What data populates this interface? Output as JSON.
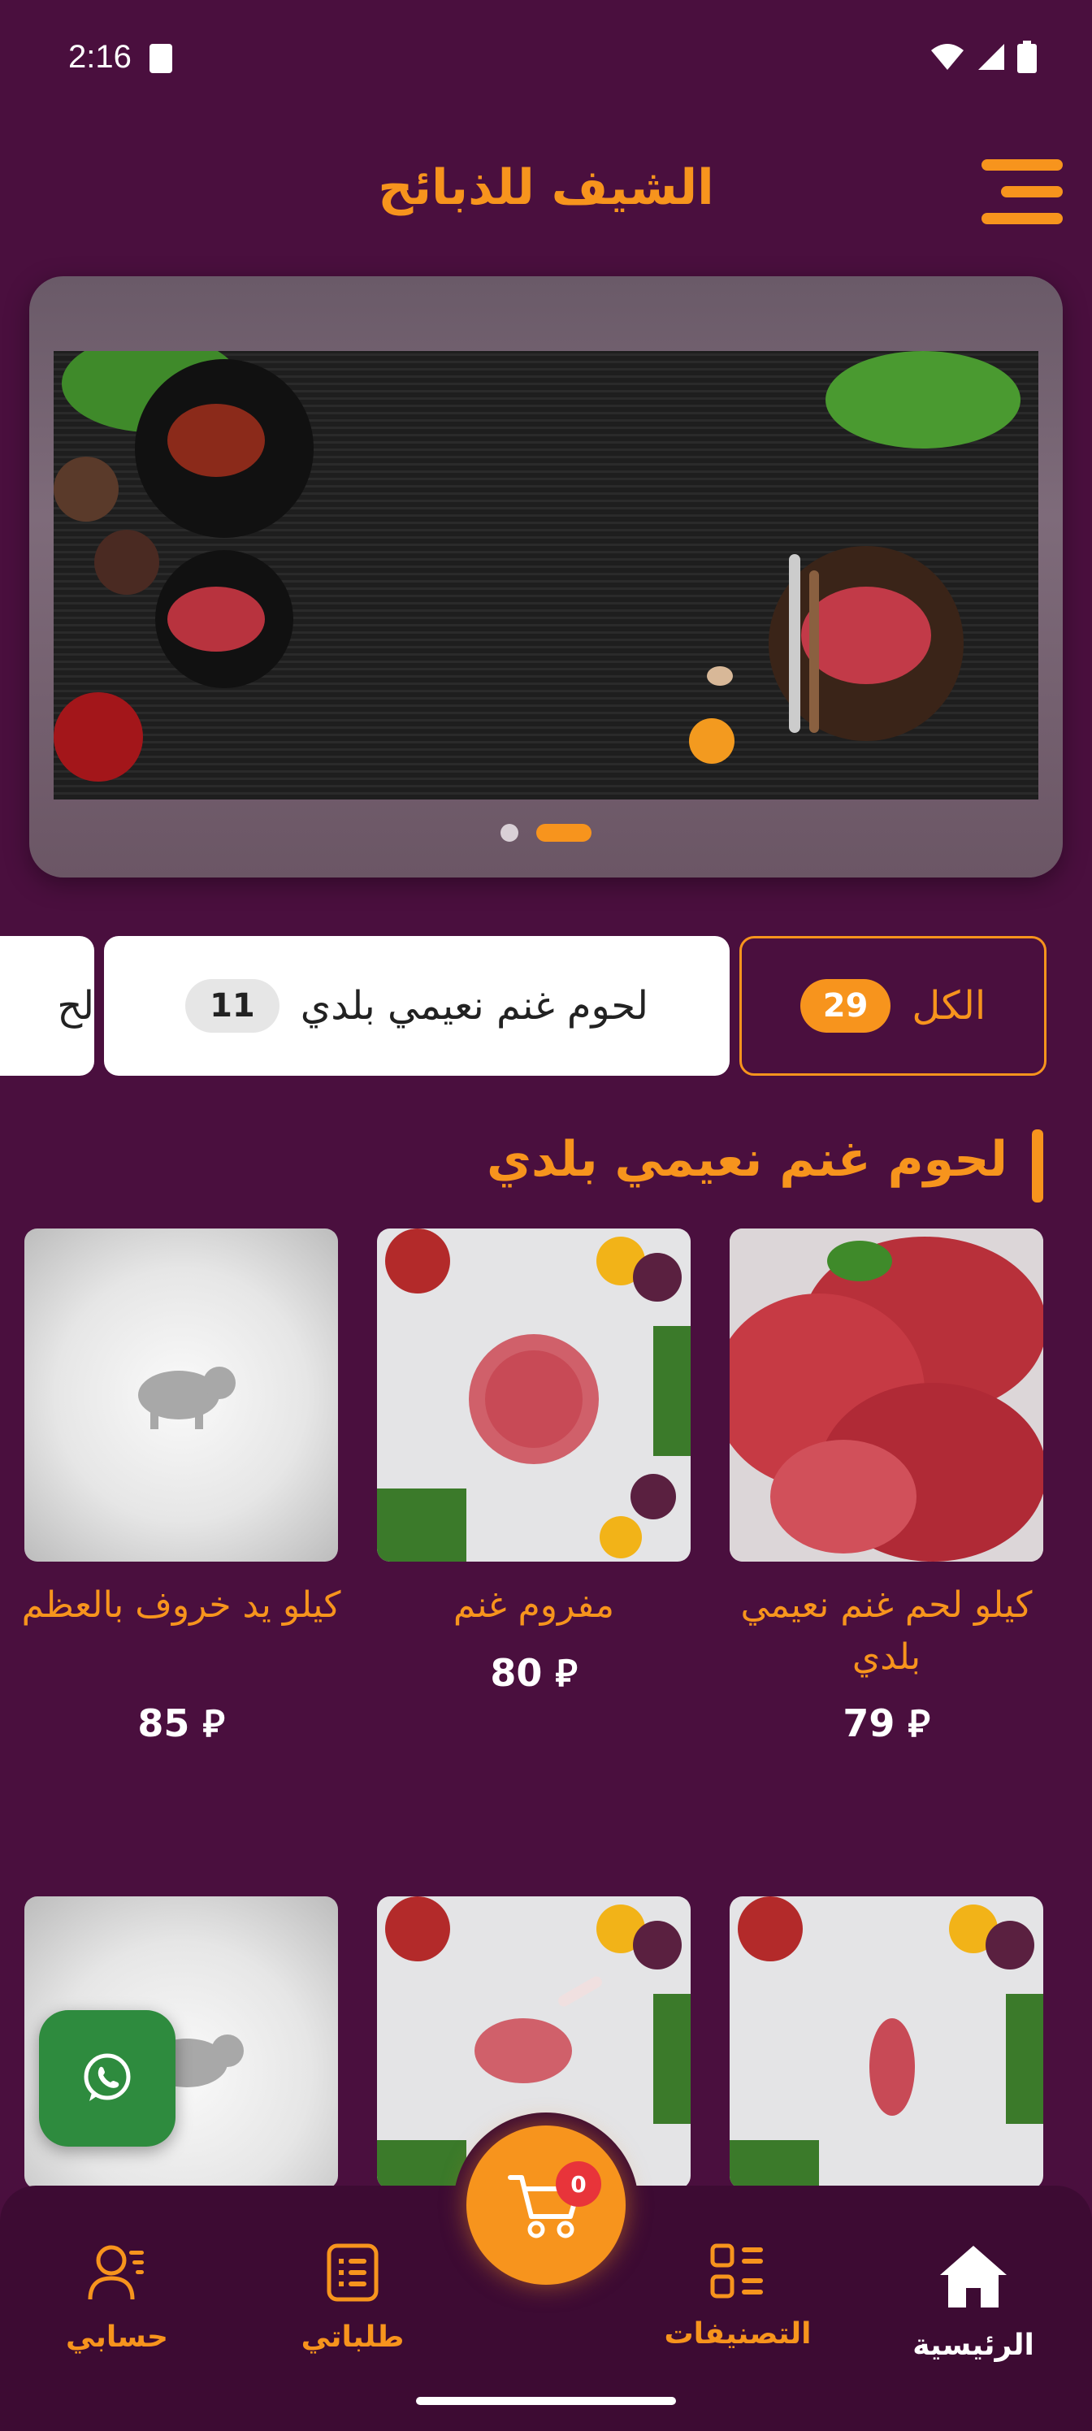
{
  "status_bar": {
    "time": "2:16"
  },
  "header": {
    "title": "الشيف للذبائح"
  },
  "banner": {
    "page_count": 2,
    "active_index": 1
  },
  "categories": [
    {
      "label": "الكل",
      "count": "29",
      "selected": true
    },
    {
      "label": "لحوم غنم نعيمي بلدي",
      "count": "11",
      "selected": false
    },
    {
      "label": "لح",
      "count": "",
      "selected": false
    }
  ],
  "section": {
    "title": "لحوم غنم نعيمي بلدي"
  },
  "currency_symbol": "⃁",
  "products": [
    {
      "name": "كيلو لحم غنم نعيمي بلدي",
      "price": "79"
    },
    {
      "name": "مفروم غنم",
      "price": "80"
    },
    {
      "name": "كيلو يد خروف بالعظم",
      "price": "85"
    }
  ],
  "cart": {
    "count": "0"
  },
  "nav": {
    "home": "الرئيسية",
    "categories": "التصنيفات",
    "orders": "طلباتي",
    "account": "حسابي"
  },
  "colors": {
    "background": "#4a0f3e",
    "accent": "#f7941d",
    "nav_bg": "#3d0b33"
  }
}
